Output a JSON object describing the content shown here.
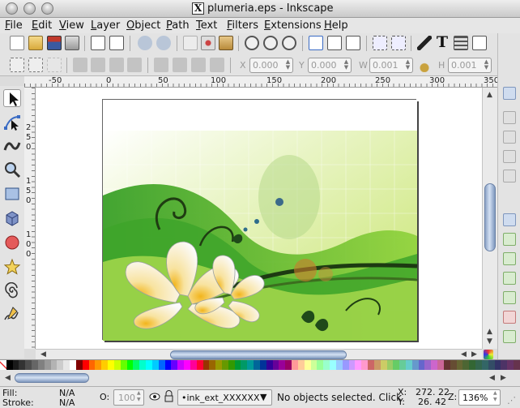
{
  "window": {
    "title": "plumeria.eps - Inkscape",
    "x_glyph": "X"
  },
  "menubar": {
    "items": [
      "File",
      "Edit",
      "View",
      "Layer",
      "Object",
      "Path",
      "Text",
      "Filters",
      "Extensions",
      "Help"
    ]
  },
  "controls_bar": {
    "x_label": "X",
    "x_value": "0.000",
    "y_label": "Y",
    "y_value": "0.000",
    "w_label": "W",
    "w_value": "0.001",
    "h_label": "H",
    "h_value": "0.001"
  },
  "ruler": {
    "h_ticks": [
      "-50",
      "0",
      "50",
      "100",
      "150",
      "200",
      "250",
      "300",
      "350"
    ],
    "v_ticks": [
      "2",
      "5",
      "0",
      "1",
      "5",
      "0",
      "1",
      "0",
      "0"
    ]
  },
  "status": {
    "fill_label": "Fill:",
    "fill_value": "N/A",
    "stroke_label": "Stroke:",
    "stroke_value": "N/A",
    "opacity_label": "O:",
    "opacity_value": "100",
    "layer_value": "•ink_ext_XXXXXX",
    "message": "No objects selected. Click",
    "x_label": "X:",
    "x_value": "272. 22",
    "y_label": "Y:",
    "y_value": "26. 42",
    "zoom_label": "Z:",
    "zoom_value": "136%"
  },
  "colors": {
    "accent": "#3a6bc4",
    "palette": [
      "#000000",
      "#1a1a1a",
      "#333333",
      "#4d4d4d",
      "#666666",
      "#808080",
      "#999999",
      "#b3b3b3",
      "#cccccc",
      "#e6e6e6",
      "#ffffff",
      "#800000",
      "#ff0000",
      "#ff6600",
      "#ff9900",
      "#ffcc00",
      "#ffff00",
      "#ccff00",
      "#66ff00",
      "#00ff00",
      "#00ff66",
      "#00ffcc",
      "#00ffff",
      "#00ccff",
      "#0066ff",
      "#0000ff",
      "#6600ff",
      "#cc00ff",
      "#ff00ff",
      "#ff0099",
      "#ff0033",
      "#993300",
      "#996600",
      "#999900",
      "#669900",
      "#339900",
      "#009933",
      "#009966",
      "#009999",
      "#006699",
      "#003399",
      "#330099",
      "#660099",
      "#990099",
      "#990066",
      "#ff9999",
      "#ffcc99",
      "#ffff99",
      "#ccff99",
      "#99ff99",
      "#99ffcc",
      "#99ffff",
      "#99ccff",
      "#9999ff",
      "#cc99ff",
      "#ff99ff",
      "#ff99cc",
      "#cc6666",
      "#cc9966",
      "#cccc66",
      "#99cc66",
      "#66cc66",
      "#66cc99",
      "#66cccc",
      "#6699cc",
      "#6666cc",
      "#9966cc",
      "#cc66cc",
      "#cc6699",
      "#663333",
      "#664d33",
      "#666633",
      "#4d6633",
      "#336633",
      "#33664d",
      "#336666",
      "#334d66",
      "#333366",
      "#4d3366",
      "#663366",
      "#66334d"
    ]
  }
}
